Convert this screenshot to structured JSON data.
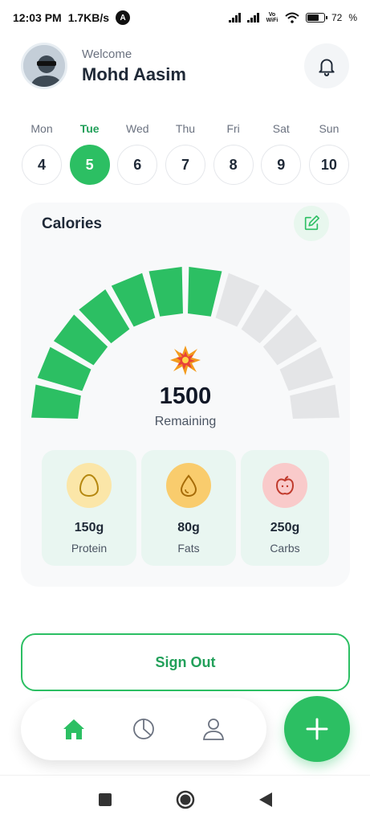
{
  "status_bar": {
    "time": "12:03 PM",
    "speed": "1.7KB/s",
    "app_badge": "A",
    "volte_label": "Vo WiFi",
    "battery": "72"
  },
  "header": {
    "welcome": "Welcome",
    "user_name": "Mohd Aasim",
    "icons": {
      "avatar": "avatar-image",
      "notifications": "bell-icon"
    }
  },
  "days": [
    {
      "label": "Mon",
      "num": "4"
    },
    {
      "label": "Tue",
      "num": "5",
      "active": true
    },
    {
      "label": "Wed",
      "num": "6"
    },
    {
      "label": "Thu",
      "num": "7"
    },
    {
      "label": "Fri",
      "num": "8"
    },
    {
      "label": "Sat",
      "num": "9"
    },
    {
      "label": "Sun",
      "num": "10"
    }
  ],
  "calories": {
    "title": "Calories",
    "remaining_value": "1500",
    "remaining_label": "Remaining",
    "gauge": {
      "total_segments": 12,
      "filled_segments": 7
    },
    "icons": {
      "edit": "edit-icon",
      "status": "burst-icon"
    }
  },
  "macros": [
    {
      "value": "150g",
      "label": "Protein",
      "icon": "egg-icon",
      "icon_bg": "#fbe6a8"
    },
    {
      "value": "80g",
      "label": "Fats",
      "icon": "drop-icon",
      "icon_bg": "#f9cc6d"
    },
    {
      "value": "250g",
      "label": "Carbs",
      "icon": "apple-icon",
      "icon_bg": "#f9caca"
    }
  ],
  "sign_out": {
    "label": "Sign Out"
  },
  "bottom_nav": {
    "items": [
      {
        "name": "home",
        "icon": "home-icon",
        "active": true
      },
      {
        "name": "stats",
        "icon": "pie-chart-icon"
      },
      {
        "name": "profile",
        "icon": "user-icon"
      }
    ],
    "fab_icon": "plus-icon"
  },
  "colors": {
    "accent": "#2cbf63",
    "accent_dark": "#22a05a",
    "gauge_empty": "#e4e5e7",
    "card_bg": "#f8f9fa",
    "macro_bg": "#e9f6f1"
  }
}
